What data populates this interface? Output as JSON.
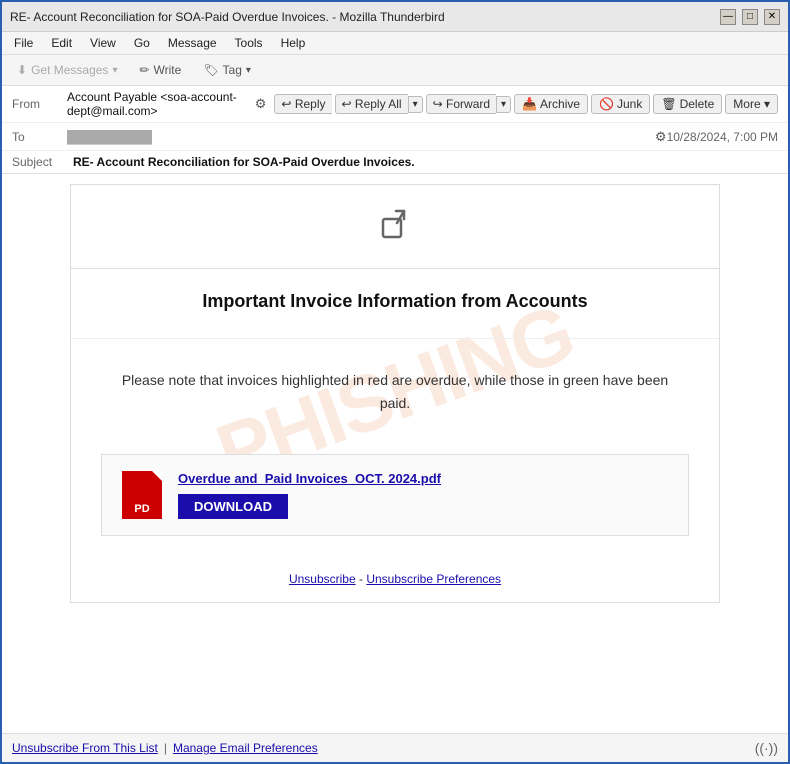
{
  "window": {
    "title": "RE- Account Reconciliation for SOA-Paid Overdue Invoices. - Mozilla Thunderbird",
    "controls": {
      "minimize": "—",
      "maximize": "□",
      "close": "✕"
    }
  },
  "menu": {
    "items": [
      "File",
      "Edit",
      "View",
      "Go",
      "Message",
      "Tools",
      "Help"
    ]
  },
  "toolbar": {
    "get_messages": "Get Messages",
    "write": "Write",
    "tag": "Tag"
  },
  "header": {
    "from_label": "From",
    "from_value": "Account Payable <soa-account-dept@mail.com>",
    "to_label": "To",
    "to_value": "",
    "subject_label": "Subject",
    "subject_value": "RE- Account Reconciliation for SOA-Paid Overdue Invoices.",
    "date": "10/28/2024, 7:00 PM",
    "reply": "Reply",
    "reply_all": "Reply All",
    "forward": "Forward",
    "archive": "Archive",
    "junk": "Junk",
    "delete": "Delete",
    "more": "More"
  },
  "email": {
    "share_icon": "↗",
    "heading": "Important Invoice Information from Accounts",
    "body_text": "Please note that invoices highlighted in red are overdue, while those in green have been paid.",
    "attachment_name": "Overdue and_Paid Invoices_OCT. 2024.pdf",
    "download_label": "DOWNLOAD",
    "pdf_label": "PD",
    "footer_unsubscribe": "Unsubscribe",
    "footer_dash": " - ",
    "footer_preferences": "Unsubscribe Preferences",
    "watermark": "PHISHING"
  },
  "bottom": {
    "unsubscribe": "Unsubscribe From This List",
    "separator": "|",
    "manage": "Manage Email Preferences",
    "signal": "((·))"
  }
}
